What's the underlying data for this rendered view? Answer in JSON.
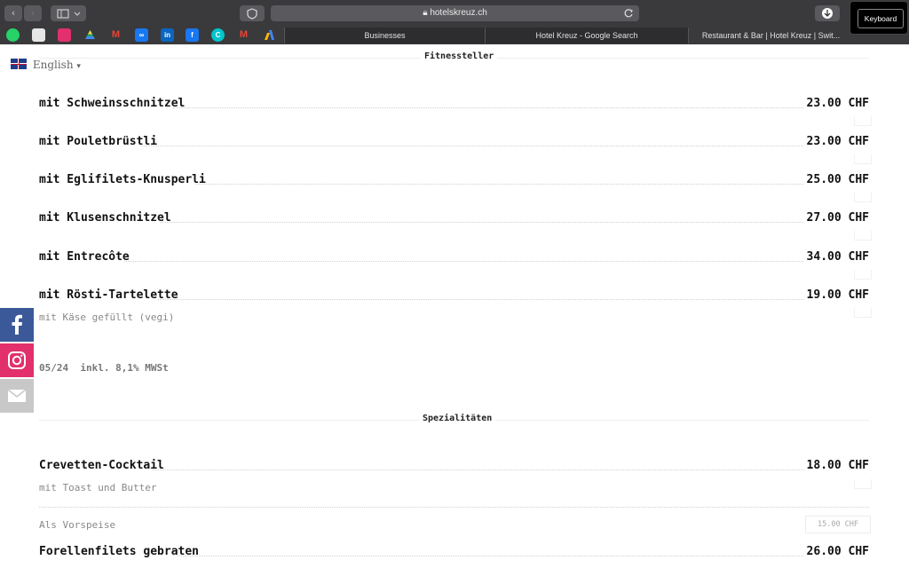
{
  "browser": {
    "url": "hotelskreuz.ch",
    "keyboard_label": "Keyboard",
    "tabs": [
      "Businesses",
      "Hotel Kreuz - Google Search",
      "Restaurant & Bar | Hotel Kreuz | Swit..."
    ],
    "favorites": [
      "whatsapp-icon",
      "notes-icon",
      "instagram-icon",
      "drive-icon",
      "gmail-icon",
      "meta-icon",
      "linkedin-icon",
      "facebook-icon",
      "canva-icon",
      "gmail-icon",
      "ads-icon"
    ]
  },
  "language": {
    "label": "English",
    "caret": "▾"
  },
  "sections": [
    {
      "title": "Fitnessteller"
    },
    {
      "title": "Spezialitäten"
    }
  ],
  "menu1": [
    {
      "name": "mit Schweinsschnitzel",
      "price": "23.00 CHF"
    },
    {
      "name": "mit Pouletbrüstli",
      "price": "23.00 CHF"
    },
    {
      "name": "mit Eglifilets-Knusperli",
      "price": "25.00 CHF"
    },
    {
      "name": "mit Klusenschnitzel",
      "price": "27.00 CHF"
    },
    {
      "name": "mit Entrecôte",
      "price": "34.00 CHF"
    },
    {
      "name": "mit Rösti-Tartelette",
      "price": "19.00 CHF",
      "desc": "mit Käse gefüllt (vegi)"
    }
  ],
  "note": "05/24  inkl. 8,1% MWSt",
  "menu2": [
    {
      "name": "Crevetten-Cocktail",
      "price": "18.00 CHF",
      "desc": "mit Toast und Butter"
    },
    {
      "name": "Als Vorspeise",
      "price": "15.00 CHF"
    },
    {
      "name": "Forellenfilets gebraten",
      "price": "26.00 CHF"
    }
  ],
  "social": [
    "facebook-icon",
    "instagram-icon",
    "mail-icon"
  ],
  "colors": {
    "facebook": "#3b5998",
    "instagram": "#e1306c",
    "mail": "#c8c8c8"
  }
}
